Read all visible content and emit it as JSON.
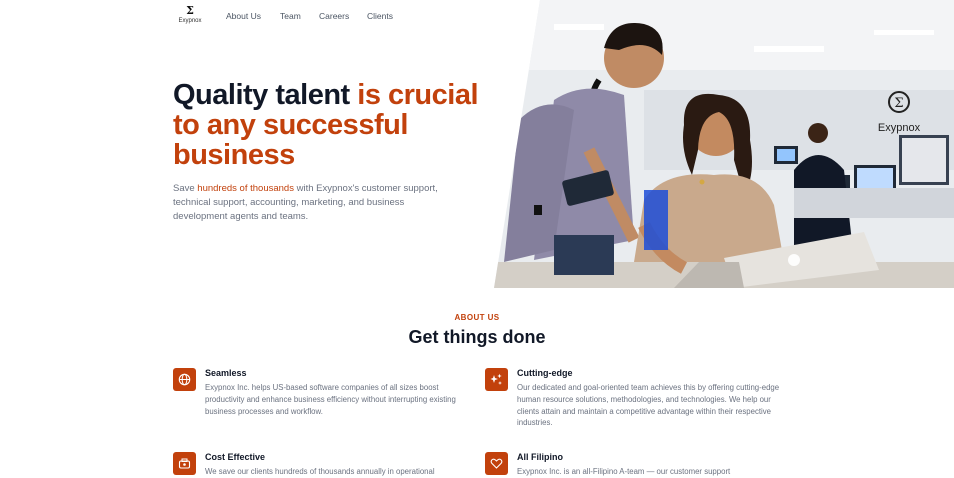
{
  "brand": {
    "symbol": "Σ",
    "name": "Exypnox"
  },
  "nav": {
    "items": [
      "About Us",
      "Team",
      "Careers",
      "Clients"
    ]
  },
  "hero": {
    "headline_part1": "Quality talent ",
    "headline_part2": "is crucial to any successful business",
    "sub_pre": "Save ",
    "sub_highlight": "hundreds of thousands",
    "sub_post": " with Exypnox's customer support, technical support, accounting, marketing, and business development agents and teams.",
    "photo_sign_symbol": "Σ",
    "photo_sign_text": "Exypnox"
  },
  "about": {
    "eyebrow": "ABOUT US",
    "title": "Get things done",
    "features": [
      {
        "icon": "globe-icon",
        "title": "Seamless",
        "desc": "Exypnox Inc. helps US-based software companies of all sizes boost productivity and enhance business efficiency without interrupting existing business processes and workflow."
      },
      {
        "icon": "sparkle-icon",
        "title": "Cutting-edge",
        "desc": "Our dedicated and goal-oriented team achieves this by offering cutting-edge human resource solutions, methodologies, and technologies. We help our clients attain and maintain a competitive advantage within their respective industries."
      },
      {
        "icon": "piggy-bank-icon",
        "title": "Cost Effective",
        "desc": "We save our clients hundreds of thousands annually in operational"
      },
      {
        "icon": "heart-icon",
        "title": "All Filipino",
        "desc": "Exypnox Inc. is an all-Filipino A-team — our customer support"
      }
    ]
  },
  "colors": {
    "accent": "#c2410c",
    "dark": "#111827",
    "muted": "#6b7280"
  }
}
